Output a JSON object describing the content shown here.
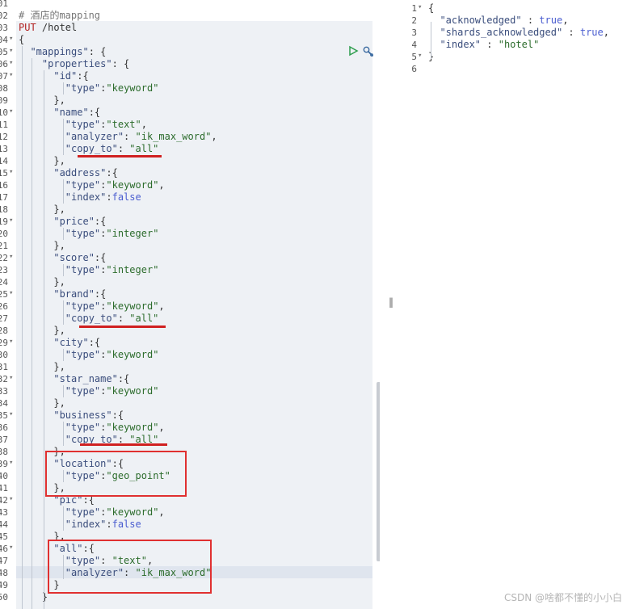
{
  "left_editor": {
    "lines": [
      {
        "n": "01",
        "t": []
      },
      {
        "n": "02",
        "t": [
          [
            "c",
            "# 酒店的mapping"
          ]
        ]
      },
      {
        "n": "03",
        "t": [
          [
            "m",
            "PUT"
          ],
          [
            "p",
            " /hotel"
          ]
        ]
      },
      {
        "n": "04",
        "f": true,
        "t": [
          [
            "p",
            "{"
          ]
        ]
      },
      {
        "n": "05",
        "f": true,
        "t": [
          [
            "k",
            "  \"mappings\""
          ],
          [
            "p",
            ": {"
          ]
        ]
      },
      {
        "n": "06",
        "f": true,
        "t": [
          [
            "k",
            "    \"properties\""
          ],
          [
            "p",
            ": {"
          ]
        ]
      },
      {
        "n": "07",
        "f": true,
        "t": [
          [
            "k",
            "      \"id\""
          ],
          [
            "p",
            ":{"
          ]
        ]
      },
      {
        "n": "08",
        "t": [
          [
            "k",
            "        \"type\""
          ],
          [
            "p",
            ":"
          ],
          [
            "s",
            "\"keyword\""
          ]
        ]
      },
      {
        "n": "09",
        "t": [
          [
            "p",
            "      },"
          ]
        ]
      },
      {
        "n": "10",
        "f": true,
        "t": [
          [
            "k",
            "      \"name\""
          ],
          [
            "p",
            ":{"
          ]
        ]
      },
      {
        "n": "11",
        "t": [
          [
            "k",
            "        \"type\""
          ],
          [
            "p",
            ":"
          ],
          [
            "s",
            "\"text\""
          ],
          [
            "p",
            ","
          ]
        ]
      },
      {
        "n": "12",
        "t": [
          [
            "k",
            "        \"analyzer\""
          ],
          [
            "p",
            ": "
          ],
          [
            "s",
            "\"ik_max_word\""
          ],
          [
            "p",
            ","
          ]
        ]
      },
      {
        "n": "13",
        "t": [
          [
            "k",
            "        \"copy_to\""
          ],
          [
            "p",
            ": "
          ],
          [
            "s",
            "\"all\""
          ]
        ]
      },
      {
        "n": "14",
        "t": [
          [
            "p",
            "      },"
          ]
        ]
      },
      {
        "n": "15",
        "f": true,
        "t": [
          [
            "k",
            "      \"address\""
          ],
          [
            "p",
            ":{"
          ]
        ]
      },
      {
        "n": "16",
        "t": [
          [
            "k",
            "        \"type\""
          ],
          [
            "p",
            ":"
          ],
          [
            "s",
            "\"keyword\""
          ],
          [
            "p",
            ","
          ]
        ]
      },
      {
        "n": "17",
        "t": [
          [
            "k",
            "        \"index\""
          ],
          [
            "p",
            ":"
          ],
          [
            "b",
            "false"
          ]
        ]
      },
      {
        "n": "18",
        "t": [
          [
            "p",
            "      },"
          ]
        ]
      },
      {
        "n": "19",
        "f": true,
        "t": [
          [
            "k",
            "      \"price\""
          ],
          [
            "p",
            ":{"
          ]
        ]
      },
      {
        "n": "20",
        "t": [
          [
            "k",
            "        \"type\""
          ],
          [
            "p",
            ":"
          ],
          [
            "s",
            "\"integer\""
          ]
        ]
      },
      {
        "n": "21",
        "t": [
          [
            "p",
            "      },"
          ]
        ]
      },
      {
        "n": "22",
        "f": true,
        "t": [
          [
            "k",
            "      \"score\""
          ],
          [
            "p",
            ":{"
          ]
        ]
      },
      {
        "n": "23",
        "t": [
          [
            "k",
            "        \"type\""
          ],
          [
            "p",
            ":"
          ],
          [
            "s",
            "\"integer\""
          ]
        ]
      },
      {
        "n": "24",
        "t": [
          [
            "p",
            "      },"
          ]
        ]
      },
      {
        "n": "25",
        "f": true,
        "t": [
          [
            "k",
            "      \"brand\""
          ],
          [
            "p",
            ":{"
          ]
        ]
      },
      {
        "n": "26",
        "t": [
          [
            "k",
            "        \"type\""
          ],
          [
            "p",
            ":"
          ],
          [
            "s",
            "\"keyword\""
          ],
          [
            "p",
            ","
          ]
        ]
      },
      {
        "n": "27",
        "t": [
          [
            "k",
            "        \"copy_to\""
          ],
          [
            "p",
            ": "
          ],
          [
            "s",
            "\"all\""
          ]
        ]
      },
      {
        "n": "28",
        "t": [
          [
            "p",
            "      },"
          ]
        ]
      },
      {
        "n": "29",
        "f": true,
        "t": [
          [
            "k",
            "      \"city\""
          ],
          [
            "p",
            ":{"
          ]
        ]
      },
      {
        "n": "30",
        "t": [
          [
            "k",
            "        \"type\""
          ],
          [
            "p",
            ":"
          ],
          [
            "s",
            "\"keyword\""
          ]
        ]
      },
      {
        "n": "31",
        "t": [
          [
            "p",
            "      },"
          ]
        ]
      },
      {
        "n": "32",
        "f": true,
        "t": [
          [
            "k",
            "      \"star_name\""
          ],
          [
            "p",
            ":{"
          ]
        ]
      },
      {
        "n": "33",
        "t": [
          [
            "k",
            "        \"type\""
          ],
          [
            "p",
            ":"
          ],
          [
            "s",
            "\"keyword\""
          ]
        ]
      },
      {
        "n": "34",
        "t": [
          [
            "p",
            "      },"
          ]
        ]
      },
      {
        "n": "35",
        "f": true,
        "t": [
          [
            "k",
            "      \"business\""
          ],
          [
            "p",
            ":{"
          ]
        ]
      },
      {
        "n": "36",
        "t": [
          [
            "k",
            "        \"type\""
          ],
          [
            "p",
            ":"
          ],
          [
            "s",
            "\"keyword\""
          ],
          [
            "p",
            ","
          ]
        ]
      },
      {
        "n": "37",
        "t": [
          [
            "k",
            "        \"copy_to\""
          ],
          [
            "p",
            ": "
          ],
          [
            "s",
            "\"all\""
          ]
        ]
      },
      {
        "n": "38",
        "t": [
          [
            "p",
            "      },"
          ]
        ]
      },
      {
        "n": "39",
        "f": true,
        "t": [
          [
            "k",
            "      \"location\""
          ],
          [
            "p",
            ":{"
          ]
        ]
      },
      {
        "n": "40",
        "t": [
          [
            "k",
            "        \"type\""
          ],
          [
            "p",
            ":"
          ],
          [
            "s",
            "\"geo_point\""
          ]
        ]
      },
      {
        "n": "41",
        "t": [
          [
            "p",
            "      },"
          ]
        ]
      },
      {
        "n": "42",
        "f": true,
        "t": [
          [
            "k",
            "      \"pic\""
          ],
          [
            "p",
            ":{"
          ]
        ]
      },
      {
        "n": "43",
        "t": [
          [
            "k",
            "        \"type\""
          ],
          [
            "p",
            ":"
          ],
          [
            "s",
            "\"keyword\""
          ],
          [
            "p",
            ","
          ]
        ]
      },
      {
        "n": "44",
        "t": [
          [
            "k",
            "        \"index\""
          ],
          [
            "p",
            ":"
          ],
          [
            "b",
            "false"
          ]
        ]
      },
      {
        "n": "45",
        "t": [
          [
            "p",
            "      },"
          ]
        ]
      },
      {
        "n": "46",
        "f": true,
        "t": [
          [
            "k",
            "      \"all\""
          ],
          [
            "p",
            ":{"
          ]
        ]
      },
      {
        "n": "47",
        "t": [
          [
            "k",
            "        \"type\""
          ],
          [
            "p",
            ": "
          ],
          [
            "s",
            "\"text\""
          ],
          [
            "p",
            ","
          ]
        ]
      },
      {
        "n": "48",
        "t": [
          [
            "k",
            "        \"analyzer\""
          ],
          [
            "p",
            ": "
          ],
          [
            "s",
            "\"ik_max_word\""
          ]
        ]
      },
      {
        "n": "49",
        "t": [
          [
            "p",
            "      }"
          ]
        ]
      },
      {
        "n": "50",
        "t": [
          [
            "p",
            "    }"
          ]
        ]
      }
    ]
  },
  "right_editor": {
    "lines": [
      {
        "n": "1",
        "f": true,
        "t": [
          [
            "p",
            "{"
          ]
        ]
      },
      {
        "n": "2",
        "t": [
          [
            "k",
            "  \"acknowledged\""
          ],
          [
            "p",
            " : "
          ],
          [
            "b",
            "true"
          ],
          [
            "p",
            ","
          ]
        ]
      },
      {
        "n": "3",
        "t": [
          [
            "k",
            "  \"shards_acknowledged\""
          ],
          [
            "p",
            " : "
          ],
          [
            "b",
            "true"
          ],
          [
            "p",
            ","
          ]
        ]
      },
      {
        "n": "4",
        "t": [
          [
            "k",
            "  \"index\""
          ],
          [
            "p",
            " : "
          ],
          [
            "s",
            "\"hotel\""
          ]
        ]
      },
      {
        "n": "5",
        "f": true,
        "t": [
          [
            "p",
            "}"
          ]
        ]
      },
      {
        "n": "6",
        "t": []
      }
    ]
  },
  "icons": {
    "run": "play-triangle-icon",
    "settings": "wrench-icon"
  },
  "colors": {
    "highlight_red": "#e03030",
    "editor_bg": "#eef1f5"
  },
  "watermark": "CSDN @啥都不懂的小小白"
}
